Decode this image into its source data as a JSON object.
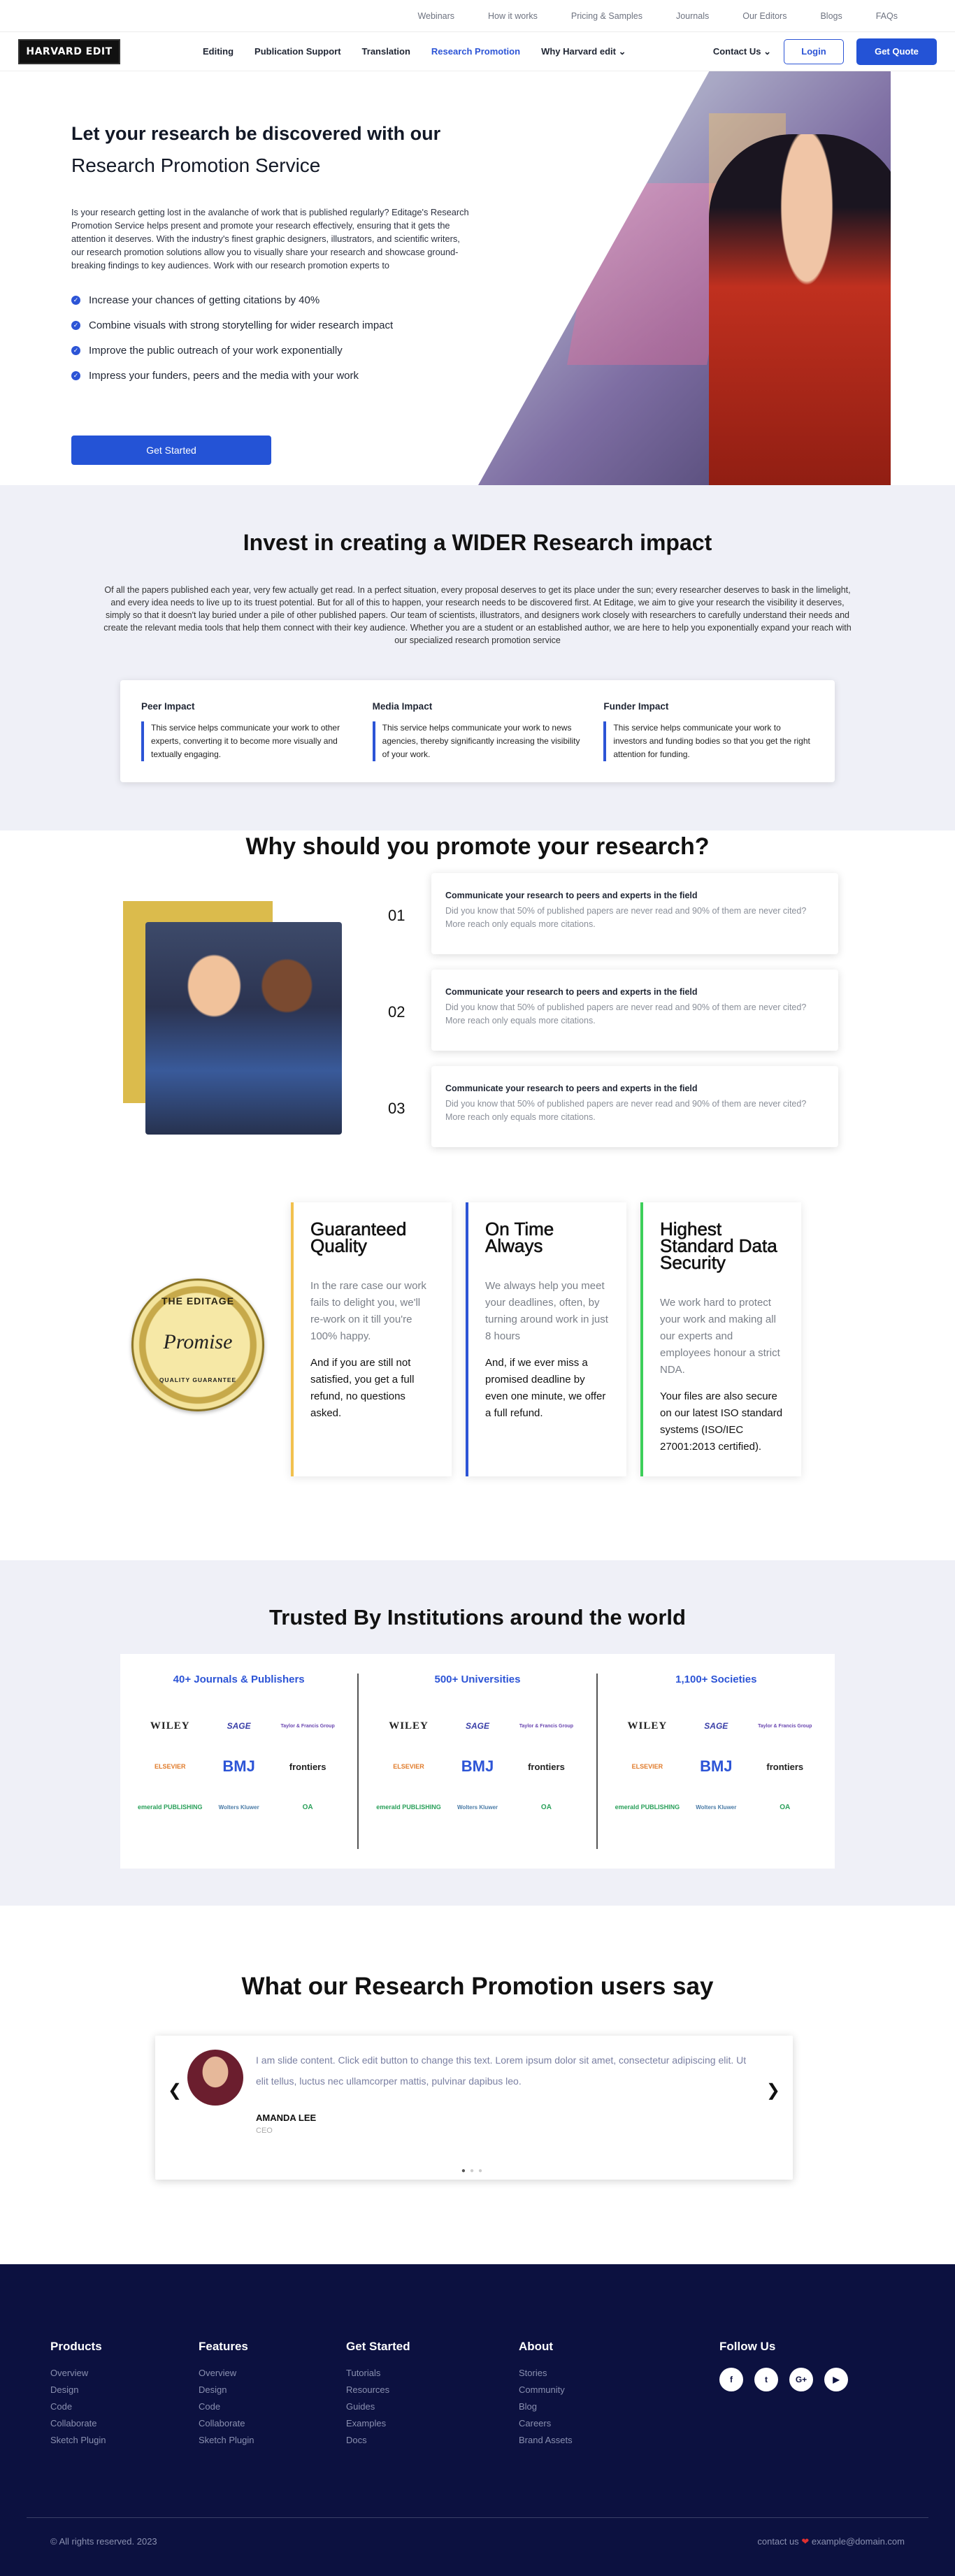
{
  "topbar": {
    "links": [
      "Webinars",
      "How it works",
      "Pricing & Samples",
      "Journals",
      "Our Editors",
      "Blogs",
      "FAQs"
    ]
  },
  "nav": {
    "logo": "HARVARD EDIT",
    "menu": [
      "Editing",
      "Publication Support",
      "Translation",
      "Research Promotion",
      "Why Harvard edit"
    ],
    "contact": "Contact Us",
    "login": "Login",
    "quote": "Get Quote"
  },
  "hero": {
    "title1": "Let your research be discovered with our",
    "title2": "Research Promotion Service",
    "body": "Is your research getting lost in the avalanche of work that is published regularly? Editage's Research Promotion Service helps present and promote your research effectively, ensuring that it gets the attention it deserves. With the industry's finest graphic designers, illustrators, and scientific writers, our research promotion solutions allow you to visually share your research and showcase ground-breaking findings to key audiences. Work with our research promotion experts to",
    "bullets": [
      "Increase your chances of getting citations by 40%",
      "Combine visuals with strong storytelling for wider research impact",
      "Improve the public outreach of your work exponentially",
      "Impress your funders, peers and the media with your work"
    ],
    "cta": "Get Started"
  },
  "impact": {
    "title": "Invest in creating a WIDER Research impact",
    "body": "Of all the papers published each year, very few actually get read. In a perfect situation, every proposal deserves to get its place under the sun; every researcher deserves to bask in the limelight, and every idea needs to live up to its truest potential. But for all of this to happen, your research needs to be discovered first. At Editage, we aim to give your research the visibility it deserves, simply so that it doesn't lay buried under a pile of other published papers. Our team of scientists, illustrators, and designers work closely with researchers to carefully understand their needs and create the relevant media tools that help them connect with their key audience. Whether you are a student or an established author, we are here to help you exponentially expand your reach with our specialized research promotion service",
    "cards": [
      {
        "title": "Peer Impact",
        "text": "This service helps communicate your work to other experts, converting it to become more visually and textually engaging."
      },
      {
        "title": "Media Impact",
        "text": "This service helps communicate your work to news agencies, thereby significantly increasing the visibility of your work."
      },
      {
        "title": "Funder Impact",
        "text": "This service helps communicate your work to investors and funding bodies so that you get the right attention for funding."
      }
    ]
  },
  "why": {
    "title": "Why should you promote your research?",
    "items": [
      {
        "num": "01",
        "title": "Communicate your research to peers and experts in the field",
        "text": "Did you know that 50% of published papers are never read and 90% of them are never cited? More reach only equals more citations."
      },
      {
        "num": "02",
        "title": "Communicate your research to peers and experts in the field",
        "text": "Did you know that 50% of published papers are never read and 90% of them are never cited? More reach only equals more citations."
      },
      {
        "num": "03",
        "title": "Communicate your research to peers and experts in the field",
        "text": "Did you know that 50% of published papers are never read and 90% of them are never cited? More reach only equals more citations."
      }
    ]
  },
  "guarantee": {
    "seal": {
      "top": "THE EDITAGE",
      "mid": "Promise",
      "bottom": "QUALITY GUARANTEE"
    },
    "cards": [
      {
        "title": "Guaranteed Quality",
        "p1": "In the rare case our work fails to delight you, we'll re-work on it till you're 100% happy.",
        "p2": "And if you are still not satisfied, you get a full refund, no questions asked.",
        "color": "#f2c14e"
      },
      {
        "title": "On Time Always",
        "p1": "We always help you meet your deadlines, often, by turning around work in just 8 hours",
        "p2": "And, if we ever miss a promised deadline by even one minute, we offer a full refund.",
        "color": "#2c54d6"
      },
      {
        "title": "Highest Standard Data Security",
        "p1": "We work hard to protect your work and making all our experts and employees honour a strict NDA.",
        "p2": "Your files are also secure on our latest ISO standard systems (ISO/IEC 27001:2013 certified).",
        "color": "#3ecf5a"
      }
    ]
  },
  "trusted": {
    "title": "Trusted By Institutions around the world",
    "cols": [
      "40+ Journals & Publishers",
      "500+ Universities",
      "1,100+ Societies"
    ],
    "logos": [
      "WILEY",
      "SAGE",
      "Taylor & Francis Group",
      "ELSEVIER",
      "BMJ",
      "frontiers",
      "emerald PUBLISHING",
      "Wolters Kluwer",
      "OA"
    ]
  },
  "users": {
    "title": "What our Research Promotion users say",
    "quote": "I am slide content. Click edit button to change this text. Lorem ipsum dolor sit amet, consectetur adipiscing elit. Ut elit tellus, luctus nec ullamcorper mattis, pulvinar dapibus leo.",
    "name": "AMANDA LEE",
    "role": "CEO"
  },
  "footer": {
    "cols": [
      {
        "title": "Products",
        "links": [
          "Overview",
          "Design",
          "Code",
          "Collaborate",
          "Sketch Plugin"
        ]
      },
      {
        "title": "Features",
        "links": [
          "Overview",
          "Design",
          "Code",
          "Collaborate",
          "Sketch Plugin"
        ]
      },
      {
        "title": "Get Started",
        "links": [
          "Tutorials",
          "Resources",
          "Guides",
          "Examples",
          "Docs"
        ]
      },
      {
        "title": "About",
        "links": [
          "Stories",
          "Community",
          "Blog",
          "Careers",
          "Brand Assets"
        ]
      }
    ],
    "follow": "Follow Us",
    "copyright": "© All rights reserved. 2023",
    "contact_prefix": "contact us",
    "email": "example@domain.com"
  }
}
